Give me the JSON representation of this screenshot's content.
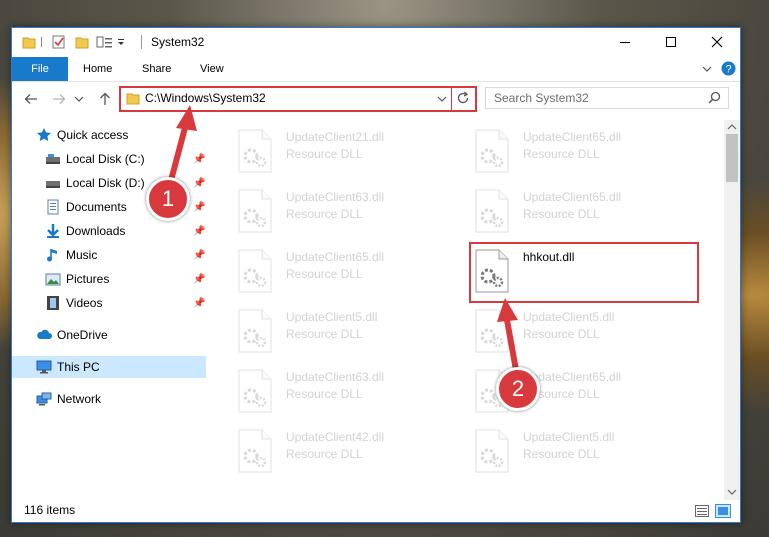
{
  "window": {
    "title": "System32"
  },
  "ribbon": {
    "file": "File",
    "home": "Home",
    "share": "Share",
    "view": "View"
  },
  "address": {
    "path": "C:\\Windows\\System32"
  },
  "search": {
    "placeholder": "Search System32"
  },
  "sidebar": {
    "quick_access": "Quick access",
    "items": [
      {
        "label": "Local Disk (C:)",
        "icon": "drive-icon"
      },
      {
        "label": "Local Disk (D:)",
        "icon": "drive-icon"
      },
      {
        "label": "Documents",
        "icon": "documents-icon"
      },
      {
        "label": "Downloads",
        "icon": "downloads-icon"
      },
      {
        "label": "Music",
        "icon": "music-icon"
      },
      {
        "label": "Pictures",
        "icon": "pictures-icon"
      },
      {
        "label": "Videos",
        "icon": "videos-icon"
      }
    ],
    "onedrive": "OneDrive",
    "this_pc": "This PC",
    "network": "Network"
  },
  "files": [
    {
      "name": "UpdateClient21.dll",
      "type": "Resource DLL"
    },
    {
      "name": "UpdateClient65.dll",
      "type": "Resource DLL"
    },
    {
      "name": "UpdateClient63.dll",
      "type": "Resource DLL"
    },
    {
      "name": "UpdateClient65.dll",
      "type": "Resource DLL"
    },
    {
      "name": "UpdateClient65.dll",
      "type": "Resource DLL"
    },
    {
      "name": "hhkout.dll",
      "type": ""
    },
    {
      "name": "UpdateClient5.dll",
      "type": "Resource DLL"
    },
    {
      "name": "UpdateClient5.dll",
      "type": "Resource DLL"
    },
    {
      "name": "UpdateClient63.dll",
      "type": "Resource DLL"
    },
    {
      "name": "UpdateClient65.dll",
      "type": "Resource DLL"
    },
    {
      "name": "UpdateClient42.dll",
      "type": "Resource DLL"
    },
    {
      "name": "UpdateClient5.dll",
      "type": "Resource DLL"
    }
  ],
  "status": {
    "count": "116 items"
  },
  "annotations": {
    "step1": "1",
    "step2": "2"
  },
  "colors": {
    "accent": "#1979ca",
    "highlight": "#d8393c",
    "selected": "#cce8ff"
  }
}
